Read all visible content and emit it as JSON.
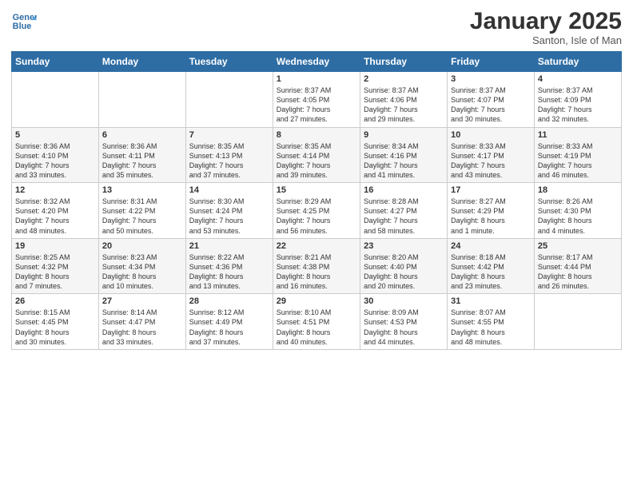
{
  "header": {
    "logo_line1": "General",
    "logo_line2": "Blue",
    "month": "January 2025",
    "location": "Santon, Isle of Man"
  },
  "days_of_week": [
    "Sunday",
    "Monday",
    "Tuesday",
    "Wednesday",
    "Thursday",
    "Friday",
    "Saturday"
  ],
  "weeks": [
    [
      {
        "day": "",
        "content": ""
      },
      {
        "day": "",
        "content": ""
      },
      {
        "day": "",
        "content": ""
      },
      {
        "day": "1",
        "content": "Sunrise: 8:37 AM\nSunset: 4:05 PM\nDaylight: 7 hours\nand 27 minutes."
      },
      {
        "day": "2",
        "content": "Sunrise: 8:37 AM\nSunset: 4:06 PM\nDaylight: 7 hours\nand 29 minutes."
      },
      {
        "day": "3",
        "content": "Sunrise: 8:37 AM\nSunset: 4:07 PM\nDaylight: 7 hours\nand 30 minutes."
      },
      {
        "day": "4",
        "content": "Sunrise: 8:37 AM\nSunset: 4:09 PM\nDaylight: 7 hours\nand 32 minutes."
      }
    ],
    [
      {
        "day": "5",
        "content": "Sunrise: 8:36 AM\nSunset: 4:10 PM\nDaylight: 7 hours\nand 33 minutes."
      },
      {
        "day": "6",
        "content": "Sunrise: 8:36 AM\nSunset: 4:11 PM\nDaylight: 7 hours\nand 35 minutes."
      },
      {
        "day": "7",
        "content": "Sunrise: 8:35 AM\nSunset: 4:13 PM\nDaylight: 7 hours\nand 37 minutes."
      },
      {
        "day": "8",
        "content": "Sunrise: 8:35 AM\nSunset: 4:14 PM\nDaylight: 7 hours\nand 39 minutes."
      },
      {
        "day": "9",
        "content": "Sunrise: 8:34 AM\nSunset: 4:16 PM\nDaylight: 7 hours\nand 41 minutes."
      },
      {
        "day": "10",
        "content": "Sunrise: 8:33 AM\nSunset: 4:17 PM\nDaylight: 7 hours\nand 43 minutes."
      },
      {
        "day": "11",
        "content": "Sunrise: 8:33 AM\nSunset: 4:19 PM\nDaylight: 7 hours\nand 46 minutes."
      }
    ],
    [
      {
        "day": "12",
        "content": "Sunrise: 8:32 AM\nSunset: 4:20 PM\nDaylight: 7 hours\nand 48 minutes."
      },
      {
        "day": "13",
        "content": "Sunrise: 8:31 AM\nSunset: 4:22 PM\nDaylight: 7 hours\nand 50 minutes."
      },
      {
        "day": "14",
        "content": "Sunrise: 8:30 AM\nSunset: 4:24 PM\nDaylight: 7 hours\nand 53 minutes."
      },
      {
        "day": "15",
        "content": "Sunrise: 8:29 AM\nSunset: 4:25 PM\nDaylight: 7 hours\nand 56 minutes."
      },
      {
        "day": "16",
        "content": "Sunrise: 8:28 AM\nSunset: 4:27 PM\nDaylight: 7 hours\nand 58 minutes."
      },
      {
        "day": "17",
        "content": "Sunrise: 8:27 AM\nSunset: 4:29 PM\nDaylight: 8 hours\nand 1 minute."
      },
      {
        "day": "18",
        "content": "Sunrise: 8:26 AM\nSunset: 4:30 PM\nDaylight: 8 hours\nand 4 minutes."
      }
    ],
    [
      {
        "day": "19",
        "content": "Sunrise: 8:25 AM\nSunset: 4:32 PM\nDaylight: 8 hours\nand 7 minutes."
      },
      {
        "day": "20",
        "content": "Sunrise: 8:23 AM\nSunset: 4:34 PM\nDaylight: 8 hours\nand 10 minutes."
      },
      {
        "day": "21",
        "content": "Sunrise: 8:22 AM\nSunset: 4:36 PM\nDaylight: 8 hours\nand 13 minutes."
      },
      {
        "day": "22",
        "content": "Sunrise: 8:21 AM\nSunset: 4:38 PM\nDaylight: 8 hours\nand 16 minutes."
      },
      {
        "day": "23",
        "content": "Sunrise: 8:20 AM\nSunset: 4:40 PM\nDaylight: 8 hours\nand 20 minutes."
      },
      {
        "day": "24",
        "content": "Sunrise: 8:18 AM\nSunset: 4:42 PM\nDaylight: 8 hours\nand 23 minutes."
      },
      {
        "day": "25",
        "content": "Sunrise: 8:17 AM\nSunset: 4:44 PM\nDaylight: 8 hours\nand 26 minutes."
      }
    ],
    [
      {
        "day": "26",
        "content": "Sunrise: 8:15 AM\nSunset: 4:45 PM\nDaylight: 8 hours\nand 30 minutes."
      },
      {
        "day": "27",
        "content": "Sunrise: 8:14 AM\nSunset: 4:47 PM\nDaylight: 8 hours\nand 33 minutes."
      },
      {
        "day": "28",
        "content": "Sunrise: 8:12 AM\nSunset: 4:49 PM\nDaylight: 8 hours\nand 37 minutes."
      },
      {
        "day": "29",
        "content": "Sunrise: 8:10 AM\nSunset: 4:51 PM\nDaylight: 8 hours\nand 40 minutes."
      },
      {
        "day": "30",
        "content": "Sunrise: 8:09 AM\nSunset: 4:53 PM\nDaylight: 8 hours\nand 44 minutes."
      },
      {
        "day": "31",
        "content": "Sunrise: 8:07 AM\nSunset: 4:55 PM\nDaylight: 8 hours\nand 48 minutes."
      },
      {
        "day": "",
        "content": ""
      }
    ]
  ]
}
